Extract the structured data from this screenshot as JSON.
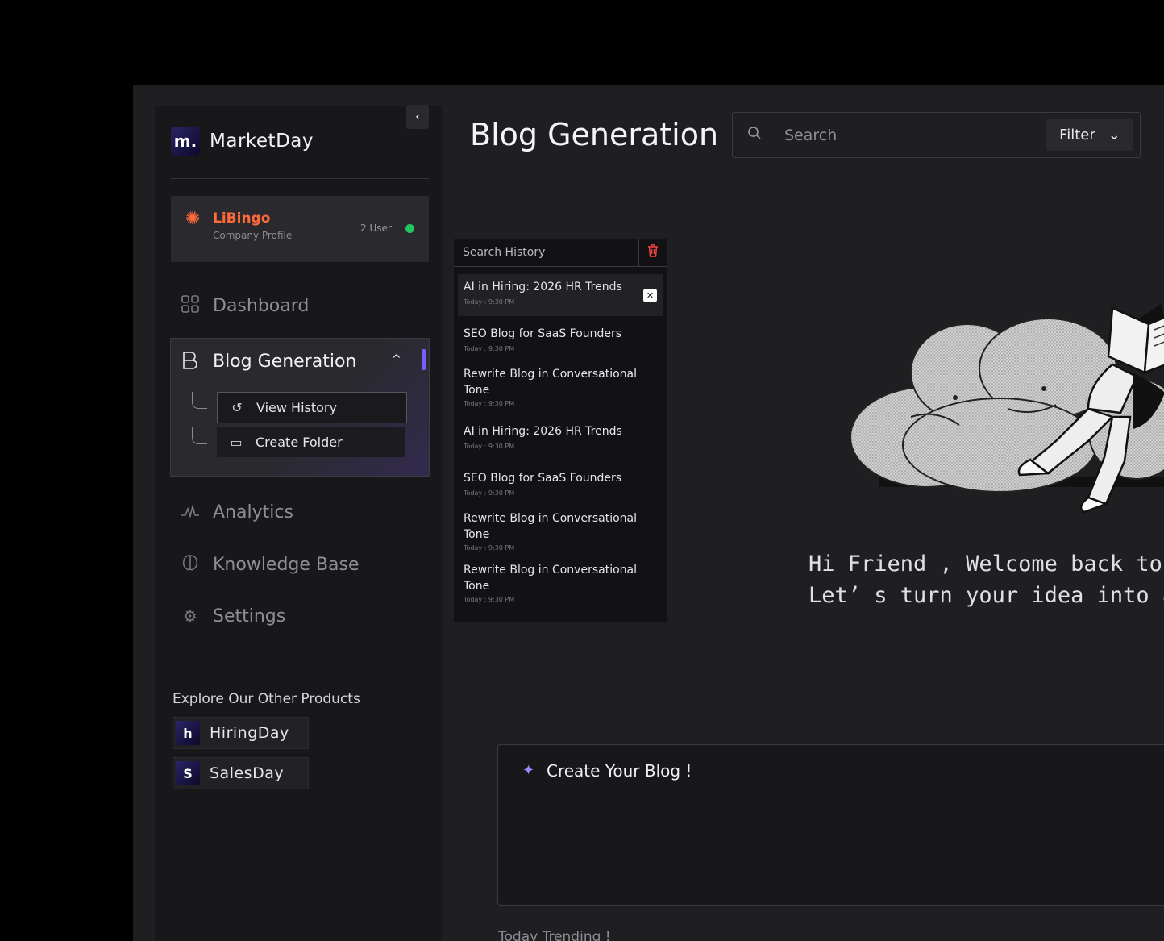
{
  "app": {
    "brand": "MarketDay",
    "logo_letter": "m.",
    "collapse_icon": "chevron-left-icon"
  },
  "company": {
    "name": "LiBingo",
    "subtitle": "Company Profile",
    "users": "2 User",
    "status_color": "#22c55e",
    "brand_color": "#ff6a3d"
  },
  "nav": {
    "dashboard": "Dashboard",
    "blog_generation": "Blog Generation",
    "view_history": "View History",
    "create_folder": "Create Folder",
    "analytics": "Analytics",
    "knowledge_base": "Knowledge Base",
    "settings": "Settings"
  },
  "explore": {
    "title": "Explore Our Other Products",
    "products": [
      {
        "name": "HiringDay",
        "logo": "h"
      },
      {
        "name": "SalesDay",
        "logo": "S"
      }
    ]
  },
  "header": {
    "title": "Blog Generation",
    "search_placeholder": "Search",
    "filter_label": "Filter"
  },
  "history": {
    "title": "Search History",
    "items": [
      {
        "title": "AI in Hiring: 2026 HR Trends",
        "time": "Today : 9:30 PM"
      },
      {
        "title": "SEO Blog for SaaS Founders",
        "time": "Today : 9:30 PM"
      },
      {
        "title": "Rewrite Blog in Conversational Tone",
        "time": "Today : 9:30 PM"
      },
      {
        "title": "AI in Hiring: 2026 HR Trends",
        "time": "Today : 9:30 PM"
      },
      {
        "title": "SEO Blog for SaaS Founders",
        "time": "Today : 9:30 PM"
      },
      {
        "title": "Rewrite Blog in Conversational Tone",
        "time": "Today : 9:30 PM"
      },
      {
        "title": "Rewrite Blog in Conversational Tone",
        "time": "Today : 9:30 PM"
      }
    ]
  },
  "welcome": {
    "line1": "Hi Friend , Welcome back to Mar",
    "line2": "Let’ s turn your idea into a hi"
  },
  "create": {
    "label": "Create Your Blog !"
  },
  "trending": {
    "label": "Today Trending !"
  },
  "colors": {
    "accent": "#7c5cff",
    "danger": "#ef4444"
  }
}
